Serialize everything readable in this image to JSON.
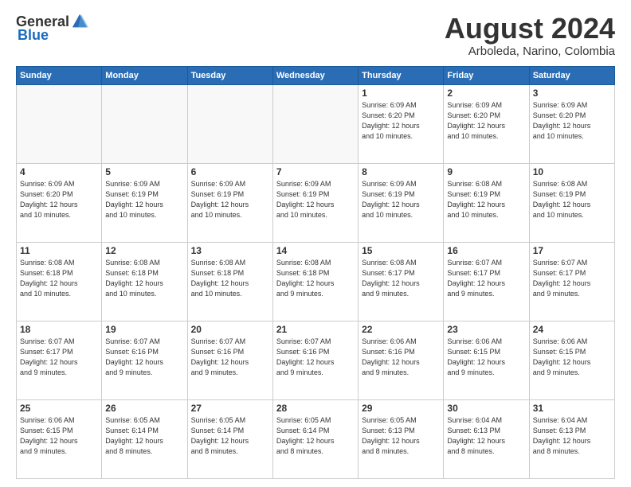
{
  "header": {
    "logo_general": "General",
    "logo_blue": "Blue",
    "month_title": "August 2024",
    "location": "Arboleda, Narino, Colombia"
  },
  "weekdays": [
    "Sunday",
    "Monday",
    "Tuesday",
    "Wednesday",
    "Thursday",
    "Friday",
    "Saturday"
  ],
  "weeks": [
    [
      {
        "day": "",
        "info": "",
        "empty": true
      },
      {
        "day": "",
        "info": "",
        "empty": true
      },
      {
        "day": "",
        "info": "",
        "empty": true
      },
      {
        "day": "",
        "info": "",
        "empty": true
      },
      {
        "day": "1",
        "info": "Sunrise: 6:09 AM\nSunset: 6:20 PM\nDaylight: 12 hours\nand 10 minutes.",
        "empty": false
      },
      {
        "day": "2",
        "info": "Sunrise: 6:09 AM\nSunset: 6:20 PM\nDaylight: 12 hours\nand 10 minutes.",
        "empty": false
      },
      {
        "day": "3",
        "info": "Sunrise: 6:09 AM\nSunset: 6:20 PM\nDaylight: 12 hours\nand 10 minutes.",
        "empty": false
      }
    ],
    [
      {
        "day": "4",
        "info": "Sunrise: 6:09 AM\nSunset: 6:20 PM\nDaylight: 12 hours\nand 10 minutes.",
        "empty": false
      },
      {
        "day": "5",
        "info": "Sunrise: 6:09 AM\nSunset: 6:19 PM\nDaylight: 12 hours\nand 10 minutes.",
        "empty": false
      },
      {
        "day": "6",
        "info": "Sunrise: 6:09 AM\nSunset: 6:19 PM\nDaylight: 12 hours\nand 10 minutes.",
        "empty": false
      },
      {
        "day": "7",
        "info": "Sunrise: 6:09 AM\nSunset: 6:19 PM\nDaylight: 12 hours\nand 10 minutes.",
        "empty": false
      },
      {
        "day": "8",
        "info": "Sunrise: 6:09 AM\nSunset: 6:19 PM\nDaylight: 12 hours\nand 10 minutes.",
        "empty": false
      },
      {
        "day": "9",
        "info": "Sunrise: 6:08 AM\nSunset: 6:19 PM\nDaylight: 12 hours\nand 10 minutes.",
        "empty": false
      },
      {
        "day": "10",
        "info": "Sunrise: 6:08 AM\nSunset: 6:19 PM\nDaylight: 12 hours\nand 10 minutes.",
        "empty": false
      }
    ],
    [
      {
        "day": "11",
        "info": "Sunrise: 6:08 AM\nSunset: 6:18 PM\nDaylight: 12 hours\nand 10 minutes.",
        "empty": false
      },
      {
        "day": "12",
        "info": "Sunrise: 6:08 AM\nSunset: 6:18 PM\nDaylight: 12 hours\nand 10 minutes.",
        "empty": false
      },
      {
        "day": "13",
        "info": "Sunrise: 6:08 AM\nSunset: 6:18 PM\nDaylight: 12 hours\nand 10 minutes.",
        "empty": false
      },
      {
        "day": "14",
        "info": "Sunrise: 6:08 AM\nSunset: 6:18 PM\nDaylight: 12 hours\nand 9 minutes.",
        "empty": false
      },
      {
        "day": "15",
        "info": "Sunrise: 6:08 AM\nSunset: 6:17 PM\nDaylight: 12 hours\nand 9 minutes.",
        "empty": false
      },
      {
        "day": "16",
        "info": "Sunrise: 6:07 AM\nSunset: 6:17 PM\nDaylight: 12 hours\nand 9 minutes.",
        "empty": false
      },
      {
        "day": "17",
        "info": "Sunrise: 6:07 AM\nSunset: 6:17 PM\nDaylight: 12 hours\nand 9 minutes.",
        "empty": false
      }
    ],
    [
      {
        "day": "18",
        "info": "Sunrise: 6:07 AM\nSunset: 6:17 PM\nDaylight: 12 hours\nand 9 minutes.",
        "empty": false
      },
      {
        "day": "19",
        "info": "Sunrise: 6:07 AM\nSunset: 6:16 PM\nDaylight: 12 hours\nand 9 minutes.",
        "empty": false
      },
      {
        "day": "20",
        "info": "Sunrise: 6:07 AM\nSunset: 6:16 PM\nDaylight: 12 hours\nand 9 minutes.",
        "empty": false
      },
      {
        "day": "21",
        "info": "Sunrise: 6:07 AM\nSunset: 6:16 PM\nDaylight: 12 hours\nand 9 minutes.",
        "empty": false
      },
      {
        "day": "22",
        "info": "Sunrise: 6:06 AM\nSunset: 6:16 PM\nDaylight: 12 hours\nand 9 minutes.",
        "empty": false
      },
      {
        "day": "23",
        "info": "Sunrise: 6:06 AM\nSunset: 6:15 PM\nDaylight: 12 hours\nand 9 minutes.",
        "empty": false
      },
      {
        "day": "24",
        "info": "Sunrise: 6:06 AM\nSunset: 6:15 PM\nDaylight: 12 hours\nand 9 minutes.",
        "empty": false
      }
    ],
    [
      {
        "day": "25",
        "info": "Sunrise: 6:06 AM\nSunset: 6:15 PM\nDaylight: 12 hours\nand 9 minutes.",
        "empty": false
      },
      {
        "day": "26",
        "info": "Sunrise: 6:05 AM\nSunset: 6:14 PM\nDaylight: 12 hours\nand 8 minutes.",
        "empty": false
      },
      {
        "day": "27",
        "info": "Sunrise: 6:05 AM\nSunset: 6:14 PM\nDaylight: 12 hours\nand 8 minutes.",
        "empty": false
      },
      {
        "day": "28",
        "info": "Sunrise: 6:05 AM\nSunset: 6:14 PM\nDaylight: 12 hours\nand 8 minutes.",
        "empty": false
      },
      {
        "day": "29",
        "info": "Sunrise: 6:05 AM\nSunset: 6:13 PM\nDaylight: 12 hours\nand 8 minutes.",
        "empty": false
      },
      {
        "day": "30",
        "info": "Sunrise: 6:04 AM\nSunset: 6:13 PM\nDaylight: 12 hours\nand 8 minutes.",
        "empty": false
      },
      {
        "day": "31",
        "info": "Sunrise: 6:04 AM\nSunset: 6:13 PM\nDaylight: 12 hours\nand 8 minutes.",
        "empty": false
      }
    ]
  ]
}
